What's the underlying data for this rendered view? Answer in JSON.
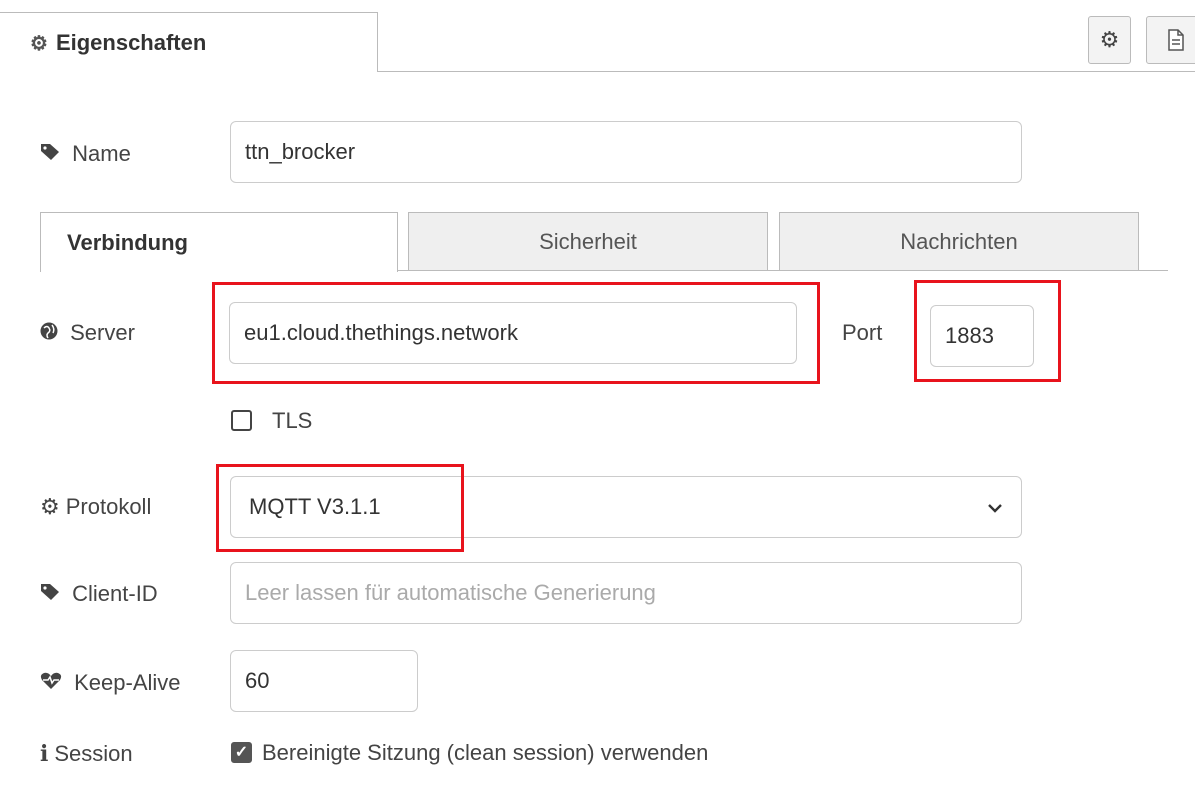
{
  "header": {
    "tab_label": "Eigenschaften",
    "tab_icon": "gear-icon",
    "settings_button_icon": "gear-icon",
    "info_button_icon": "document-icon"
  },
  "form": {
    "name": {
      "label": "Name",
      "icon": "tag-icon",
      "value": "ttn_brocker"
    },
    "tabs": [
      {
        "label": "Verbindung",
        "active": true
      },
      {
        "label": "Sicherheit",
        "active": false
      },
      {
        "label": "Nachrichten",
        "active": false
      }
    ],
    "server": {
      "label": "Server",
      "icon": "globe-icon",
      "value": "eu1.cloud.thethings.network"
    },
    "port": {
      "label": "Port",
      "value": "1883"
    },
    "tls": {
      "label": "TLS",
      "checked": false
    },
    "protocol": {
      "label": "Protokoll",
      "icon": "gear-icon",
      "value": "MQTT V3.1.1"
    },
    "client_id": {
      "label": "Client-ID",
      "icon": "tag-icon",
      "placeholder": "Leer lassen für automatische Generierung",
      "value": ""
    },
    "keep_alive": {
      "label": "Keep-Alive",
      "icon": "heartbeat-icon",
      "value": "60"
    },
    "session": {
      "label": "Session",
      "icon": "info-icon",
      "checkbox_label": "Bereinigte Sitzung (clean session) verwenden",
      "checked": true
    }
  },
  "colors": {
    "highlight": "#e8131c",
    "border": "#cccccc",
    "inactive_tab": "#efefef"
  }
}
